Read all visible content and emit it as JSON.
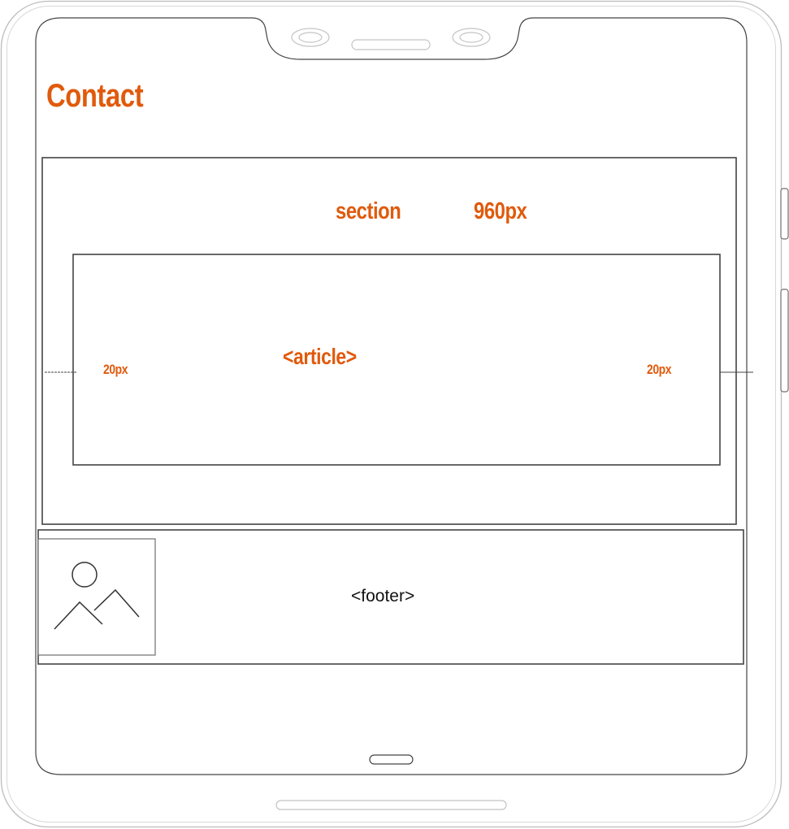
{
  "page": {
    "title": "Contact"
  },
  "section": {
    "label": "section",
    "width_label": "960px"
  },
  "article": {
    "label": "<article>",
    "margin_left_label": "20px",
    "margin_right_label": "20px"
  },
  "footer": {
    "label": "<footer>",
    "image_icon": "image-placeholder-icon"
  },
  "colors": {
    "accent": "#e05a0c",
    "outline": "#444444",
    "device": "#6e6e6e"
  }
}
